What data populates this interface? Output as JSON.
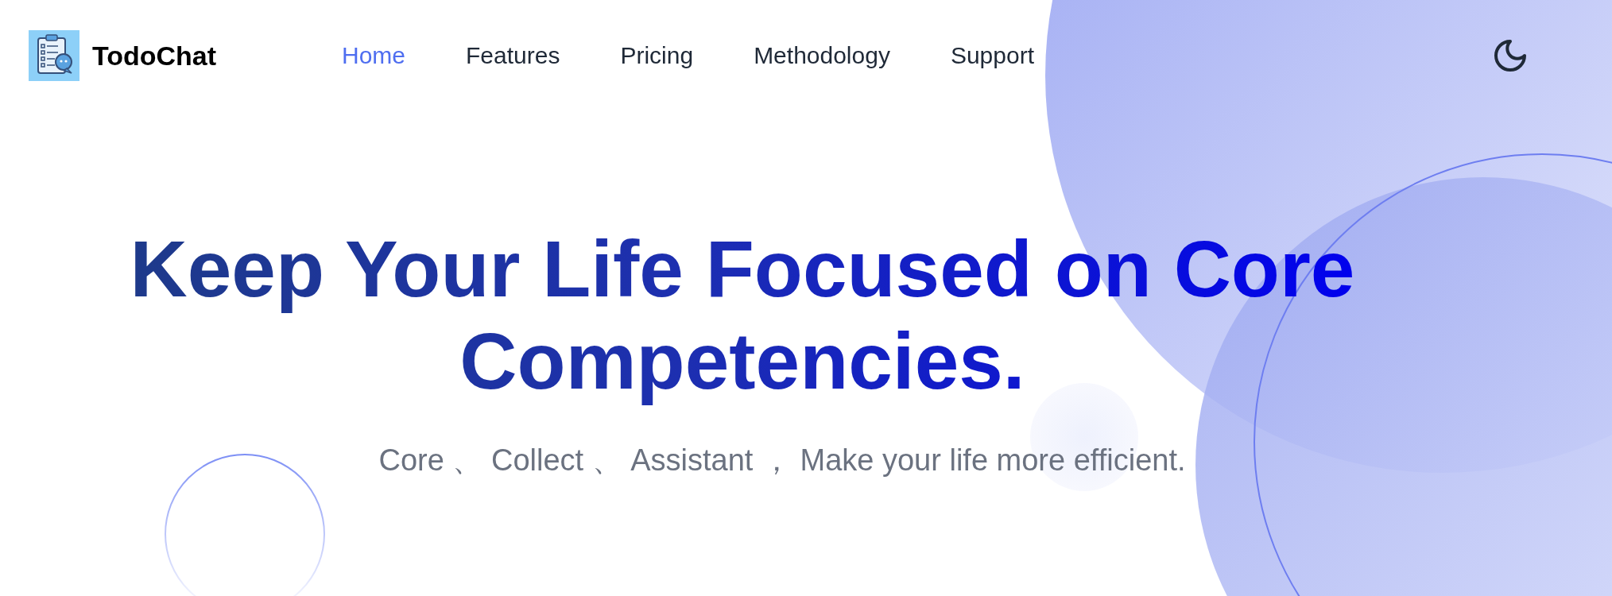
{
  "brand": {
    "name": "TodoChat"
  },
  "nav": [
    {
      "label": "Home",
      "selected": true
    },
    {
      "label": "Features",
      "selected": false
    },
    {
      "label": "Pricing",
      "selected": false
    },
    {
      "label": "Methodology",
      "selected": false
    },
    {
      "label": "Support",
      "selected": false
    }
  ],
  "hero": {
    "title": "Keep Your Life Focused on Core Competencies.",
    "subtitle": "Core 、 Collect 、 Assistant ， Make your life more efficient."
  }
}
